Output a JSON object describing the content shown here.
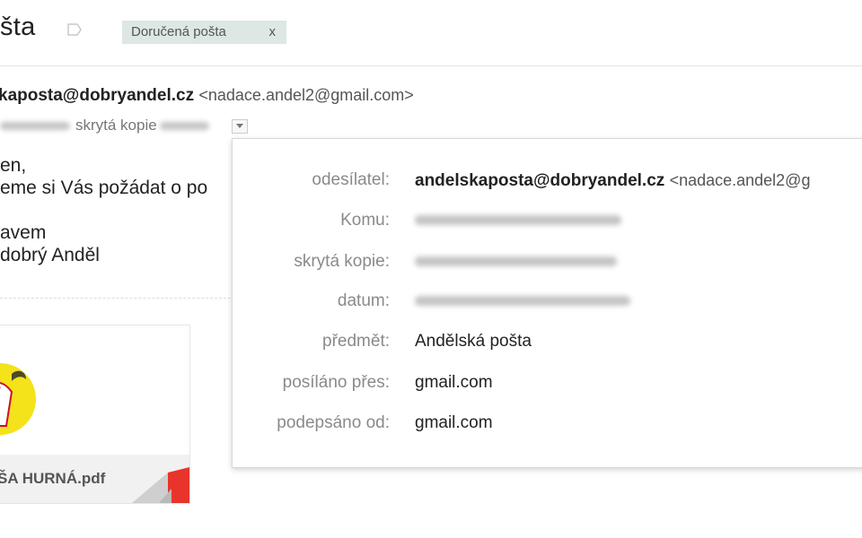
{
  "header": {
    "subject": "šta",
    "label_chip": "Doručená pošta",
    "label_chip_close": "x"
  },
  "message": {
    "sender_name": "kaposta@dobryandel.cz",
    "sender_address": "<nadace.andel2@gmail.com>",
    "recipient_text": "skrytá kopie",
    "body_lines": [
      "en,",
      "eme si Vás požádat o po",
      "",
      "avem",
      " dobrý Anděl"
    ]
  },
  "attachment": {
    "filename": "ŠA HURNÁ.pdf"
  },
  "details": {
    "rows": [
      {
        "label": "odesílatel:",
        "value_strong": "andelskaposta@dobryandel.cz",
        "value_soft": "<nadace.andel2@g"
      },
      {
        "label": "Komu:",
        "value": ""
      },
      {
        "label": "skrytá kopie:",
        "value": ""
      },
      {
        "label": "datum:",
        "value": ""
      },
      {
        "label": "předmět:",
        "value": "Andělská pošta"
      },
      {
        "label": "posíláno přes:",
        "value": "gmail.com"
      },
      {
        "label": "podepsáno od:",
        "value": "gmail.com"
      }
    ]
  },
  "colors": {
    "chip_bg": "#dde7e4",
    "logo_yellow": "#f4e21a",
    "corner_red": "#e8342a"
  },
  "icons": [
    "label-icon",
    "dropdown-arrow-icon",
    "pdf-corner-icon",
    "angel-logo"
  ]
}
